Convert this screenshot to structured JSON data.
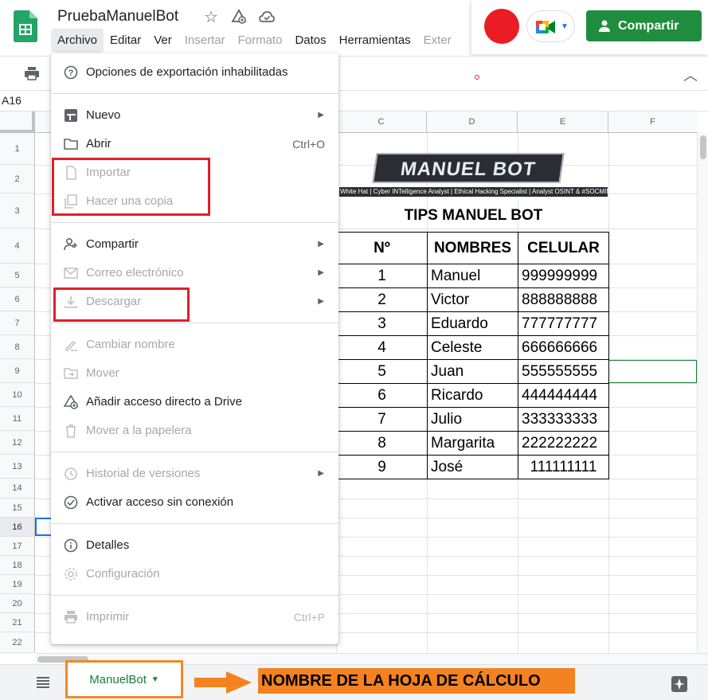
{
  "doc": {
    "title": "PruebaManuelBot",
    "name_box": "A16"
  },
  "menubar": [
    "Archivo",
    "Editar",
    "Ver",
    "Insertar",
    "Formato",
    "Datos",
    "Herramientas",
    "Exter"
  ],
  "share": {
    "label": "Compartir"
  },
  "columns": [
    "C",
    "D",
    "E",
    "F"
  ],
  "rows": [
    "1",
    "2",
    "3",
    "4",
    "5",
    "6",
    "7",
    "8",
    "9",
    "10",
    "11",
    "12",
    "13",
    "14",
    "15",
    "16",
    "17",
    "18",
    "19",
    "20",
    "21",
    "22"
  ],
  "sheet_content": {
    "logo_text": "MANUEL BOT",
    "logo_subtitle": "White Hat | Cyber INTelligence Analyst | Ethical Hacking Specialist | Analyst OSINT & #SOCMINT",
    "title": "TIPS MANUEL BOT",
    "headers": [
      "Nº",
      "NOMBRES",
      "CELULAR"
    ],
    "rows": [
      [
        "1",
        "Manuel",
        "999999999"
      ],
      [
        "2",
        "Victor",
        "888888888"
      ],
      [
        "3",
        "Eduardo",
        "777777777"
      ],
      [
        "4",
        "Celeste",
        "666666666"
      ],
      [
        "5",
        "Juan",
        "555555555"
      ],
      [
        "6",
        "Ricardo",
        "444444444"
      ],
      [
        "7",
        "Julio",
        "333333333"
      ],
      [
        "8",
        "Margarita",
        "222222222"
      ],
      [
        "9",
        "José",
        "111111111"
      ]
    ]
  },
  "file_menu": {
    "export_disabled": "Opciones de exportación inhabilitadas",
    "nuevo": "Nuevo",
    "abrir": "Abrir",
    "abrir_shortcut": "Ctrl+O",
    "importar": "Importar",
    "copia": "Hacer una copia",
    "compartir": "Compartir",
    "correo": "Correo electrónico",
    "descargar": "Descargar",
    "renombrar": "Cambiar nombre",
    "mover": "Mover",
    "acceso_directo": "Añadir acceso directo a Drive",
    "papelera": "Mover a la papelera",
    "historial": "Historial de versiones",
    "sin_conexion": "Activar acceso sin conexión",
    "detalles": "Detalles",
    "configuracion": "Configuración",
    "imprimir": "Imprimir",
    "imprimir_shortcut": "Ctrl+P"
  },
  "sheet_tab": {
    "label": "ManuelBot"
  },
  "annotation": {
    "label": "NOMBRE DE LA HOJA DE CÁLCULO"
  },
  "colors": {
    "accent_green": "#1e8e3e",
    "annotation_orange": "#f58220",
    "highlight_red": "#e1202a"
  }
}
